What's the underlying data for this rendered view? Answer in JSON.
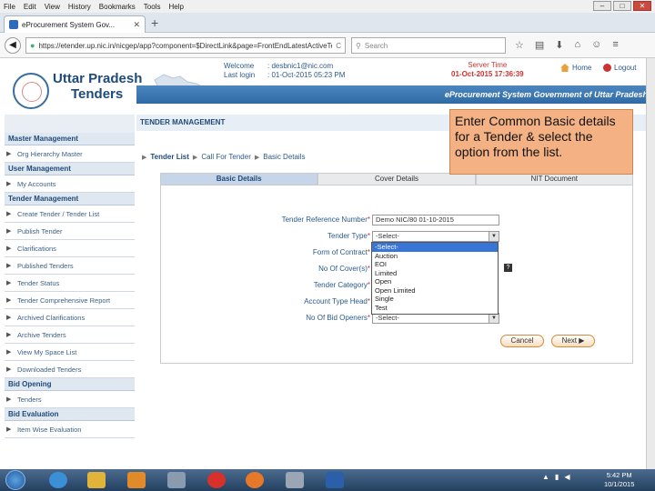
{
  "browser": {
    "menu": [
      "File",
      "Edit",
      "View",
      "History",
      "Bookmarks",
      "Tools",
      "Help"
    ],
    "tab_title": "eProcurement System Gov...",
    "url": "https://etender.up.nic.in/nicgep/app?component=$DirectLink&page=FrontEndLatestActiveTenders&service=direct",
    "search_placeholder": "Search"
  },
  "header": {
    "brand_line1": "Uttar Pradesh",
    "brand_line2": "Tenders",
    "welcome_label": "Welcome",
    "welcome_value": "desbnic1@nic.com",
    "lastlogin_label": "Last login",
    "lastlogin_value": "01-Oct-2015 05:23 PM",
    "server_time_label": "Server Time",
    "server_time_value": "01-Oct-2015 17:36:39",
    "home": "Home",
    "logout": "Logout",
    "system_title": "eProcurement System Government of Uttar Pradesh"
  },
  "sidebar": [
    {
      "type": "head",
      "label": "Master Management"
    },
    {
      "type": "item",
      "label": "Org Hierarchy Master"
    },
    {
      "type": "head",
      "label": "User Management"
    },
    {
      "type": "item",
      "label": "My Accounts"
    },
    {
      "type": "head",
      "label": "Tender Management"
    },
    {
      "type": "item",
      "label": "Create Tender / Tender List"
    },
    {
      "type": "item",
      "label": "Publish Tender"
    },
    {
      "type": "item",
      "label": "Clarifications"
    },
    {
      "type": "item",
      "label": "Published Tenders"
    },
    {
      "type": "item",
      "label": "Tender Status"
    },
    {
      "type": "item",
      "label": "Tender Comprehensive Report"
    },
    {
      "type": "item",
      "label": "Archived Clarifications"
    },
    {
      "type": "item",
      "label": "Archive Tenders"
    },
    {
      "type": "item",
      "label": "View My Space List"
    },
    {
      "type": "item",
      "label": "Downloaded Tenders"
    },
    {
      "type": "head",
      "label": "Bid Opening"
    },
    {
      "type": "item",
      "label": "Tenders"
    },
    {
      "type": "head",
      "label": "Bid Evaluation"
    },
    {
      "type": "item",
      "label": "Item Wise Evaluation"
    }
  ],
  "content": {
    "section_title": "TENDER MANAGEMENT",
    "crumbs": [
      "Tender List",
      "Call For Tender",
      "Basic Details"
    ],
    "tabs": [
      "Basic Details",
      "Cover Details",
      "NIT Document"
    ],
    "form": {
      "ref_label": "Tender Reference Number",
      "ref_value": "Demo NIC/80 01-10-2015",
      "type_label": "Tender Type",
      "type_value": "-Select-",
      "form_label": "Form of Contract",
      "covers_label": "No Of Cover(s)",
      "category_label": "Tender Category",
      "account_label": "Account Type Head",
      "bid_openers_label": "No Of Bid Openers",
      "bid_openers_value": "-Select-",
      "options": [
        "-Select-",
        "Auction",
        "EOI",
        "Limited",
        "Open",
        "Open Limited",
        "Single",
        "Test"
      ]
    },
    "cancel": "Cancel",
    "next": "Next"
  },
  "callout": "Enter Common Basic details for a Tender & select the option from the list.",
  "taskbar": {
    "time": "5:42 PM",
    "date": "10/1/2015"
  },
  "colors": {
    "brand_blue": "#1f4a78",
    "bar_blue": "#2f6aa5",
    "callout_orange": "#f4b183",
    "server_red": "#cc3333"
  }
}
